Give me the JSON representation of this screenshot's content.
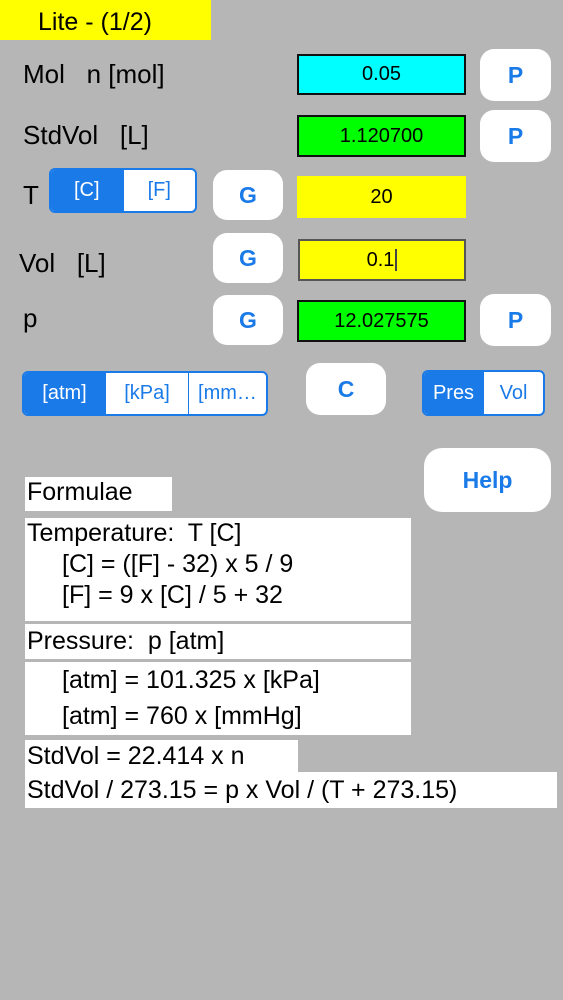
{
  "title": "Lite - (1/2)",
  "rows": {
    "mol": {
      "label": "Mol   n [mol]",
      "value": "0.05",
      "btn": "P"
    },
    "stdvol": {
      "label": "StdVol   [L]",
      "value": "1.120700",
      "btn": "P"
    },
    "temp": {
      "label": "T",
      "units": [
        "[C]",
        "[F]"
      ],
      "selected_unit": "[C]",
      "gbtn": "G",
      "value": "20"
    },
    "vol": {
      "label": "Vol   [L]",
      "gbtn": "G",
      "value": "0.1"
    },
    "pres": {
      "label": "p",
      "gbtn": "G",
      "value": "12.027575",
      "btn": "P"
    }
  },
  "pressure_units": [
    "[atm]",
    "[kPa]",
    "[mm…"
  ],
  "selected_pressure_unit": "[atm]",
  "clear_btn": "C",
  "mode_toggle": [
    "Pres",
    "Vol"
  ],
  "selected_mode": "Pres",
  "help_btn": "Help",
  "formulae": {
    "heading": "Formulae",
    "temp_title": "Temperature:  T [C]",
    "temp_line1": "[C] = ([F] - 32) x 5 / 9",
    "temp_line2": "[F] = 9 x [C] / 5 + 32",
    "pres_title": "Pressure:  p [atm]",
    "pres_line1": "[atm] = 101.325 x [kPa]",
    "pres_line2": "[atm] = 760 x [mmHg]",
    "std_line1": "StdVol = 22.414 x n",
    "std_line2": "StdVol / 273.15 = p x Vol / (T + 273.15)"
  },
  "colors": {
    "accent": "#1a7ae8",
    "background": "#b6b6b6",
    "input_yellow": "#ffff00",
    "output_green": "#00ff00",
    "input_cyan": "#00ffff"
  }
}
